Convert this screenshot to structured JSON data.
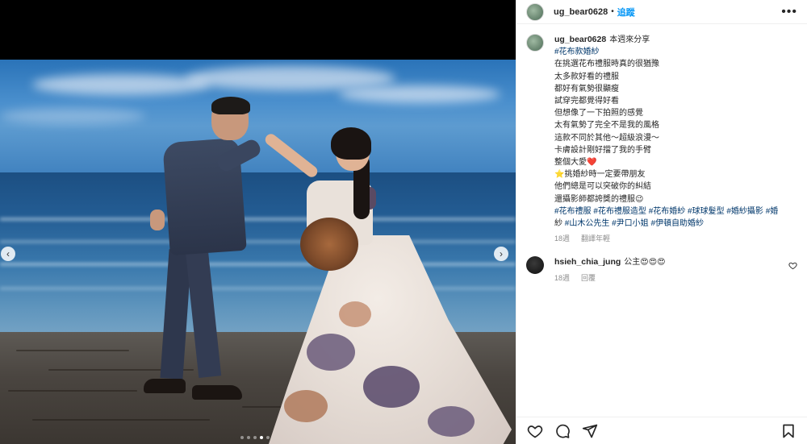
{
  "post": {
    "username": "ug_bear0628",
    "follow_label": "追蹤",
    "more_label": "•••",
    "caption": {
      "intro": "本週來分享",
      "lines": [
        "#花布款婚紗",
        "在挑選花布禮服時真的很猶豫",
        "太多款好看的禮服",
        "都好有氣勢很顯瘦",
        "試穿完都覺得好看",
        "但想像了一下拍照的感覺",
        "太有氣勢了完全不是我的風格",
        "這款不同於其他～超級浪漫～",
        "卡膚設計剛好擋了我的手臂",
        "整個大愛❤️",
        "⭐挑婚紗時一定要帶朋友",
        "他們總是可以突破你的糾結",
        "還攝影師都誇獎的禮服😉",
        "#花布禮服 #花布禮服造型 #花布婚紗 #球球髮型 #婚紗攝影 #婚",
        "紗 #山木公先生 #尹口小姐 #伊頓自助婚紗"
      ],
      "time": "18週",
      "translate_label": "翻譯年輕"
    },
    "comment": {
      "username": "hsieh_chia_jung",
      "text": "公主😍😍😍",
      "time": "18週",
      "reply_label": "回覆"
    }
  },
  "carousel": {
    "prev_label": "‹",
    "next_label": "›",
    "dot_count": 5,
    "active_index": 3
  },
  "icons": {
    "like": "heart-icon",
    "comment": "comment-icon",
    "share": "share-icon",
    "save": "bookmark-icon"
  },
  "colors": {
    "accent": "#0095f6",
    "hashtag": "#00376b"
  }
}
